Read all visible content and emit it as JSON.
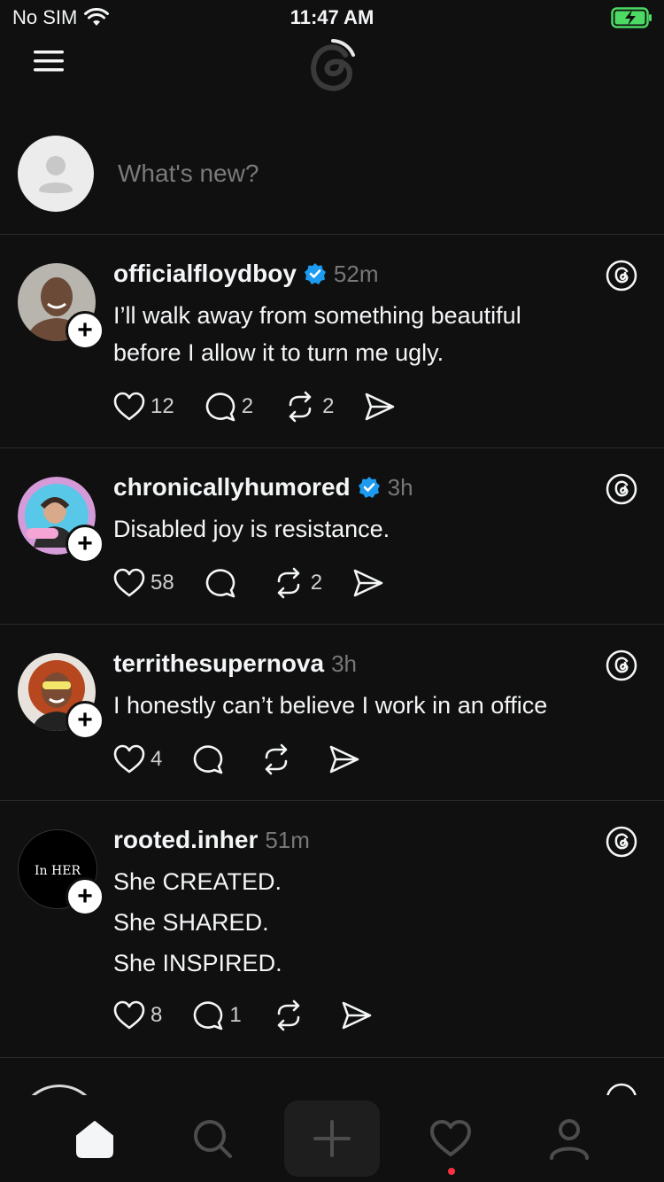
{
  "status_bar": {
    "carrier": "No SIM",
    "time": "11:47 AM"
  },
  "composer": {
    "placeholder": "What's new?"
  },
  "posts": [
    {
      "username": "officialfloydboy",
      "verified": true,
      "time": "52m",
      "lines": [
        "I’ll walk away from something beautiful",
        "before I allow it to turn me ugly."
      ],
      "likes": "12",
      "replies": "2",
      "reposts": "2"
    },
    {
      "username": "chronicallyhumored",
      "verified": true,
      "time": "3h",
      "lines": [
        "Disabled joy is resistance."
      ],
      "likes": "58",
      "replies": "",
      "reposts": "2"
    },
    {
      "username": "territhesupernova",
      "verified": false,
      "time": "3h",
      "lines": [
        "I honestly can’t believe I work in an office"
      ],
      "likes": "4",
      "replies": "",
      "reposts": ""
    },
    {
      "username": "rooted.inher",
      "verified": false,
      "time": "51m",
      "lines": [
        "She CREATED.",
        "She SHARED.",
        "She INSPIRED."
      ],
      "likes": "8",
      "replies": "1",
      "reposts": ""
    }
  ],
  "avatar_texts": {
    "rooted_inher": "In HER"
  },
  "tab_bar": {
    "tabs": [
      "home-icon",
      "search-icon",
      "create-icon",
      "heart-icon",
      "profile-icon"
    ],
    "active": "home-icon",
    "notification_dot_color": "#ff3040"
  },
  "colors": {
    "background": "#101010",
    "verified": "#1d9bf0",
    "battery": "#4cd964"
  }
}
